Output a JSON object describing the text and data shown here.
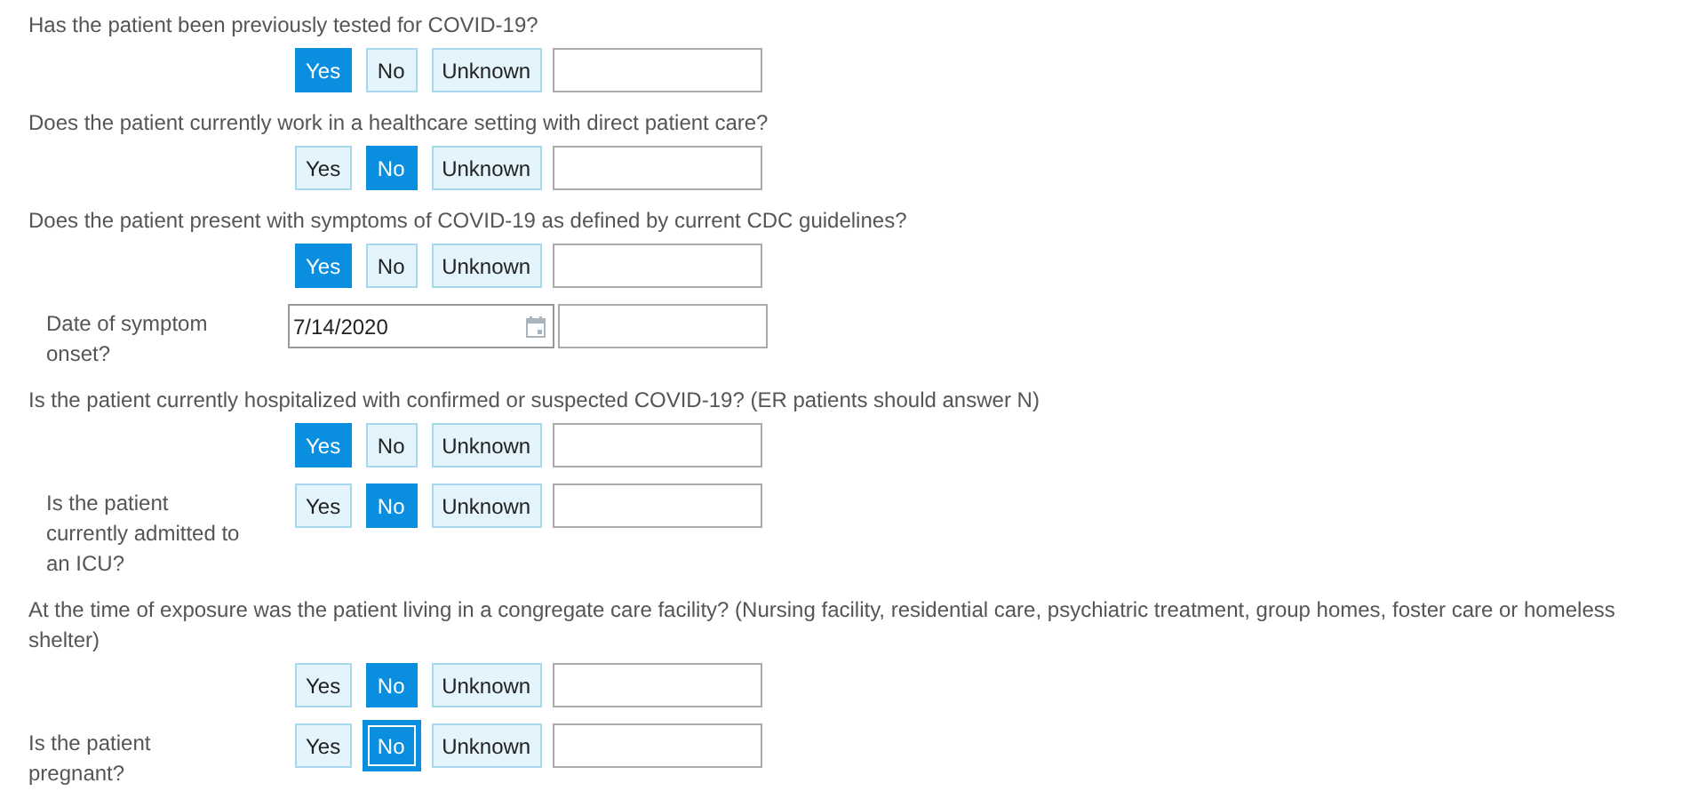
{
  "items": [
    {
      "kind": "question",
      "label": "Has the patient been previously tested for COVID-19?",
      "options": [
        {
          "label": "Yes",
          "selected": true
        },
        {
          "label": "No",
          "selected": false
        },
        {
          "label": "Unknown",
          "selected": false
        }
      ]
    },
    {
      "kind": "question",
      "label": "Does the patient currently work in a healthcare setting with direct patient care?",
      "options": [
        {
          "label": "Yes",
          "selected": false
        },
        {
          "label": "No",
          "selected": true
        },
        {
          "label": "Unknown",
          "selected": false
        }
      ]
    },
    {
      "kind": "question",
      "label": "Does the patient present with symptoms of COVID-19 as defined by current CDC guidelines?",
      "options": [
        {
          "label": "Yes",
          "selected": true
        },
        {
          "label": "No",
          "selected": false
        },
        {
          "label": "Unknown",
          "selected": false
        }
      ]
    },
    {
      "kind": "date",
      "label": "Date of symptom onset?",
      "indent": true,
      "value": "7/14/2020"
    },
    {
      "kind": "question",
      "label": "Is the patient currently hospitalized with confirmed or suspected COVID-19? (ER patients should answer N)",
      "options": [
        {
          "label": "Yes",
          "selected": true
        },
        {
          "label": "No",
          "selected": false
        },
        {
          "label": "Unknown",
          "selected": false
        }
      ]
    },
    {
      "kind": "sub",
      "label": "Is the patient currently admitted to an ICU?",
      "indent": true,
      "options": [
        {
          "label": "Yes",
          "selected": false
        },
        {
          "label": "No",
          "selected": true
        },
        {
          "label": "Unknown",
          "selected": false
        }
      ]
    },
    {
      "kind": "question",
      "label": "At the time of exposure was the patient living in a congregate care facility? (Nursing facility, residential care, psychiatric treatment, group homes, foster care or homeless shelter)",
      "options": [
        {
          "label": "Yes",
          "selected": false
        },
        {
          "label": "No",
          "selected": true
        },
        {
          "label": "Unknown",
          "selected": false
        }
      ]
    },
    {
      "kind": "sub",
      "label": "Is the patient pregnant?",
      "indent": false,
      "options": [
        {
          "label": "Yes",
          "selected": false,
          "focused": false
        },
        {
          "label": "No",
          "selected": true,
          "focused": true
        },
        {
          "label": "Unknown",
          "selected": false,
          "focused": false
        }
      ]
    }
  ]
}
